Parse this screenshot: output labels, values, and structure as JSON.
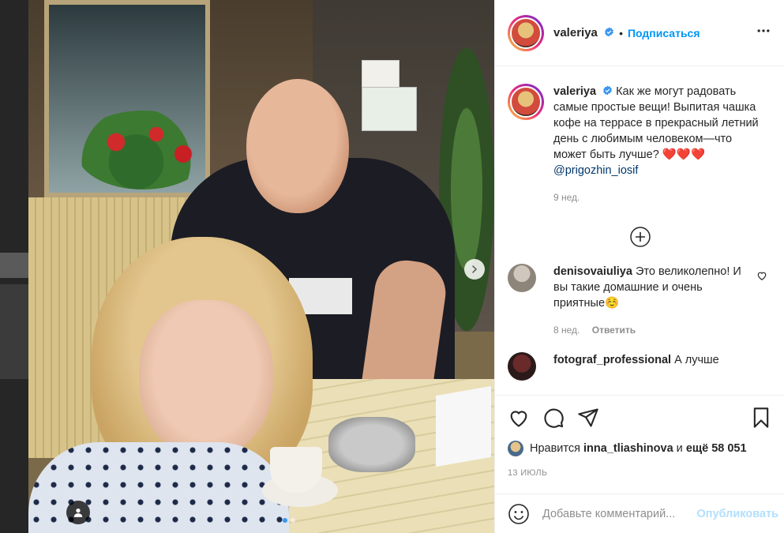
{
  "post": {
    "username": "valeriya",
    "follow_label": "Подписаться",
    "separator": "•",
    "caption_text": "Как же могут радовать самые простые вещи! Выпитая чашка кофе на террасе в прекрасный летний день с любимым человеком—что может быть лучше?",
    "caption_hearts": "❤️❤️❤️",
    "mention": "@prigozhin_iosif",
    "caption_time": "9 нед.",
    "carousel": {
      "current": 1,
      "total": 2
    },
    "comments": [
      {
        "username": "denisovaiuliya",
        "text": "Это великолепно! И вы такие домашние и очень приятные☺️",
        "time": "8 нед.",
        "reply_label": "Ответить"
      },
      {
        "username": "fotograf_professional",
        "text": "А лучше"
      }
    ],
    "likes": {
      "prefix": "Нравится",
      "user": "inna_tliashinova",
      "middle": "и",
      "others": "ещё 58 051"
    },
    "date": "13 ИЮЛЬ",
    "comment_input": {
      "placeholder": "Добавьте комментарий...",
      "publish_label": "Опубликовать"
    }
  },
  "colors": {
    "accent": "#0095f6",
    "verified": "#3897f0",
    "heart": "#ed4956",
    "publish_disabled": "#b2dffc"
  },
  "icons": [
    "verified-badge-icon",
    "more-options-icon",
    "load-more-comments-icon",
    "comment-like-icon",
    "like-heart-icon",
    "comment-bubble-icon",
    "share-plane-icon",
    "bookmark-icon",
    "emoji-icon",
    "carousel-next-icon",
    "user-tag-icon"
  ]
}
